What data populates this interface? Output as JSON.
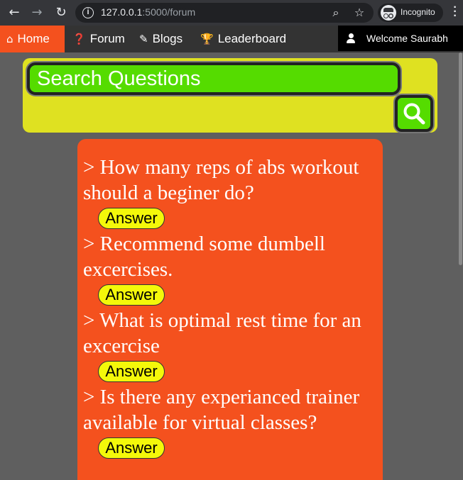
{
  "browser": {
    "url_host": "127.0.0.1",
    "url_rest": ":5000/forum",
    "incognito_label": "Incognito"
  },
  "navbar": {
    "items": [
      {
        "label": "Home",
        "icon": "home-icon",
        "active": true
      },
      {
        "label": "Forum",
        "icon": "question-circle-icon",
        "active": false
      },
      {
        "label": "Blogs",
        "icon": "blog-icon",
        "active": false
      },
      {
        "label": "Leaderboard",
        "icon": "trophy-icon",
        "active": false
      }
    ],
    "welcome": "Welcome Saurabh"
  },
  "search": {
    "placeholder": "Search Questions"
  },
  "questions": [
    {
      "text": "> How many reps of abs workout should a beginer do?",
      "button": "Answer"
    },
    {
      "text": "> Recommend some dumbell excercises.",
      "button": "Answer"
    },
    {
      "text": "> What is optimal rest time for an excercise",
      "button": "Answer"
    },
    {
      "text": "> Is there any experianced trainer available for virtual classes?",
      "button": "Answer"
    }
  ],
  "colors": {
    "accent": "#f4511e",
    "search_panel": "#dfe121",
    "search_field": "#55dc00",
    "answer_button": "#f4f80a",
    "navbar": "#333333",
    "page_bg": "#5f5f5f"
  }
}
